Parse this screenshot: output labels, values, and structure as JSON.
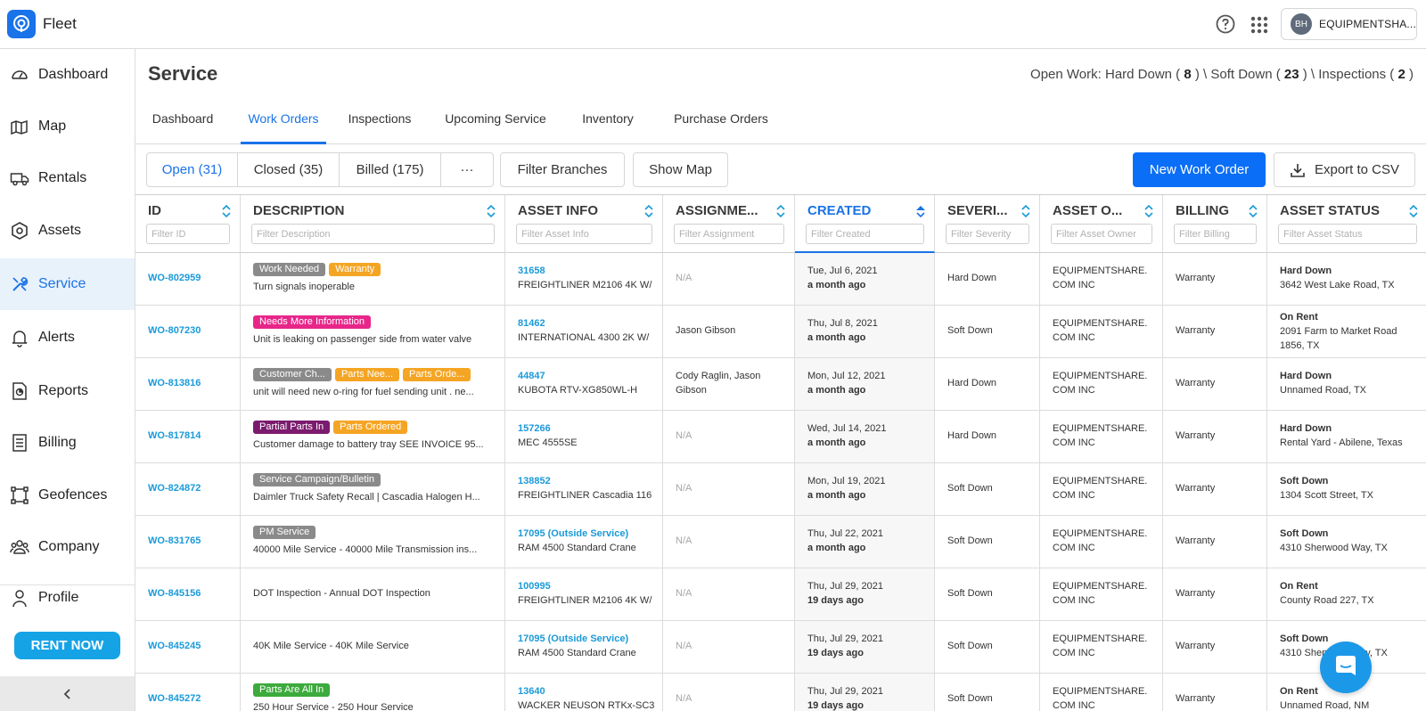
{
  "app": {
    "name": "Fleet"
  },
  "account": {
    "initials": "BH",
    "name": "EQUIPMENTSHA..."
  },
  "sidebar": {
    "items": [
      {
        "label": "Dashboard",
        "icon": "dashboard-icon"
      },
      {
        "label": "Map",
        "icon": "map-icon"
      },
      {
        "label": "Rentals",
        "icon": "truck-icon"
      },
      {
        "label": "Assets",
        "icon": "hexagon-icon"
      },
      {
        "label": "Service",
        "icon": "wrench-icon",
        "active": true
      },
      {
        "label": "Alerts",
        "icon": "bell-icon"
      },
      {
        "label": "Reports",
        "icon": "report-icon"
      },
      {
        "label": "Billing",
        "icon": "billing-icon"
      },
      {
        "label": "Geofences",
        "icon": "geofence-icon"
      },
      {
        "label": "Company",
        "icon": "company-icon"
      },
      {
        "label": "Profile",
        "icon": "profile-icon"
      }
    ],
    "rent_now": "RENT NOW"
  },
  "page": {
    "title": "Service",
    "open_work_label": "Open Work:",
    "hard_down_label": "Hard Down (",
    "hard_down_count": "8",
    "soft_down_label": ") \\ Soft Down (",
    "soft_down_count": "23",
    "inspections_label": ") \\ Inspections (",
    "inspections_count": "2",
    "close_paren": ")"
  },
  "tabs": [
    "Dashboard",
    "Work Orders",
    "Inspections",
    "Upcoming Service",
    "Inventory",
    "Purchase Orders"
  ],
  "toolbar": {
    "open": "Open (31)",
    "closed": "Closed (35)",
    "billed": "Billed (175)",
    "more": "···",
    "filter_branches": "Filter Branches",
    "show_map": "Show Map",
    "new_work_order": "New Work Order",
    "export": "Export to CSV"
  },
  "columns": [
    {
      "label": "ID",
      "placeholder": "Filter ID"
    },
    {
      "label": "DESCRIPTION",
      "placeholder": "Filter Description"
    },
    {
      "label": "ASSET INFO",
      "placeholder": "Filter Asset Info"
    },
    {
      "label": "ASSIGNME...",
      "placeholder": "Filter Assignment"
    },
    {
      "label": "CREATED",
      "placeholder": "Filter Created"
    },
    {
      "label": "SEVERI...",
      "placeholder": "Filter Severity"
    },
    {
      "label": "ASSET O...",
      "placeholder": "Filter Asset Owner"
    },
    {
      "label": "BILLING",
      "placeholder": "Filter Billing"
    },
    {
      "label": "ASSET STATUS",
      "placeholder": "Filter Asset Status"
    }
  ],
  "tag_colors": {
    "gray": "#8a8a8a",
    "orange": "#f5a524",
    "pink": "#e8268a",
    "purple": "#7b1b6e",
    "green": "#3caa3c"
  },
  "rows": [
    {
      "id": "WO-802959",
      "tags": [
        {
          "text": "Work Needed",
          "color": "gray"
        },
        {
          "text": "Warranty",
          "color": "orange"
        }
      ],
      "desc": "Turn signals inoperable",
      "asset_id": "31658",
      "asset_name": "FREIGHTLINER M2106 4K W/",
      "assignment": "N/A",
      "assignment_na": true,
      "created_date": "Tue, Jul 6, 2021",
      "created_ago": "a month ago",
      "severity": "Hard Down",
      "owner1": "EQUIPMENTSHARE.",
      "owner2": "COM INC",
      "billing": "Warranty",
      "status": "Hard Down",
      "location": "3642 West Lake Road, TX"
    },
    {
      "id": "WO-807230",
      "tags": [
        {
          "text": "Needs More Information",
          "color": "pink"
        }
      ],
      "desc": "Unit is leaking on passenger side from water valve",
      "asset_id": "81462",
      "asset_name": "INTERNATIONAL 4300 2K W/",
      "assignment": "Jason Gibson",
      "created_date": "Thu, Jul 8, 2021",
      "created_ago": "a month ago",
      "severity": "Soft Down",
      "owner1": "EQUIPMENTSHARE.",
      "owner2": "COM INC",
      "billing": "Warranty",
      "status": "On Rent",
      "location": "2091 Farm to Market Road",
      "location2": "1856, TX"
    },
    {
      "id": "WO-813816",
      "tags": [
        {
          "text": "Customer Ch...",
          "color": "gray"
        },
        {
          "text": "Parts Nee...",
          "color": "orange"
        },
        {
          "text": "Parts Orde...",
          "color": "orange"
        }
      ],
      "desc": "unit will need new o-ring for fuel sending unit . ne...",
      "asset_id": "44847",
      "asset_name": "KUBOTA RTV-XG850WL-H",
      "assignment": "Cody Raglin, Jason",
      "assignment2": "Gibson",
      "created_date": "Mon, Jul 12, 2021",
      "created_ago": "a month ago",
      "severity": "Hard Down",
      "owner1": "EQUIPMENTSHARE.",
      "owner2": "COM INC",
      "billing": "Warranty",
      "status": "Hard Down",
      "location": "Unnamed Road, TX"
    },
    {
      "id": "WO-817814",
      "tags": [
        {
          "text": "Partial Parts In",
          "color": "purple"
        },
        {
          "text": "Parts Ordered",
          "color": "orange"
        }
      ],
      "desc": "Customer damage to battery tray SEE INVOICE 95...",
      "asset_id": "157266",
      "asset_name": "MEC 4555SE",
      "assignment": "N/A",
      "assignment_na": true,
      "created_date": "Wed, Jul 14, 2021",
      "created_ago": "a month ago",
      "severity": "Hard Down",
      "owner1": "EQUIPMENTSHARE.",
      "owner2": "COM INC",
      "billing": "Warranty",
      "status": "Hard Down",
      "location": "Rental Yard - Abilene, Texas"
    },
    {
      "id": "WO-824872",
      "tags": [
        {
          "text": "Service Campaign/Bulletin",
          "color": "gray"
        }
      ],
      "desc": "Daimler Truck Safety Recall | Cascadia Halogen H...",
      "asset_id": "138852",
      "asset_name": "FREIGHTLINER Cascadia 116",
      "assignment": "N/A",
      "assignment_na": true,
      "created_date": "Mon, Jul 19, 2021",
      "created_ago": "a month ago",
      "severity": "Soft Down",
      "owner1": "EQUIPMENTSHARE.",
      "owner2": "COM INC",
      "billing": "Warranty",
      "status": "Soft Down",
      "location": "1304 Scott Street, TX"
    },
    {
      "id": "WO-831765",
      "tags": [
        {
          "text": "PM Service",
          "color": "gray"
        }
      ],
      "desc": "40000 Mile Service - 40000 Mile Transmission ins...",
      "asset_id": "17095 (Outside Service)",
      "asset_name": "RAM 4500 Standard Crane",
      "assignment": "N/A",
      "assignment_na": true,
      "created_date": "Thu, Jul 22, 2021",
      "created_ago": "a month ago",
      "severity": "Soft Down",
      "owner1": "EQUIPMENTSHARE.",
      "owner2": "COM INC",
      "billing": "Warranty",
      "status": "Soft Down",
      "location": "4310 Sherwood Way, TX"
    },
    {
      "id": "WO-845156",
      "tags": [],
      "desc": "DOT Inspection - Annual DOT Inspection",
      "asset_id": "100995",
      "asset_name": "FREIGHTLINER M2106 4K W/",
      "assignment": "N/A",
      "assignment_na": true,
      "created_date": "Thu, Jul 29, 2021",
      "created_ago": "19 days ago",
      "severity": "Soft Down",
      "owner1": "EQUIPMENTSHARE.",
      "owner2": "COM INC",
      "billing": "Warranty",
      "status": "On Rent",
      "location": "County Road 227, TX"
    },
    {
      "id": "WO-845245",
      "tags": [],
      "desc": "40K Mile Service - 40K Mile Service",
      "asset_id": "17095 (Outside Service)",
      "asset_name": "RAM 4500 Standard Crane",
      "assignment": "N/A",
      "assignment_na": true,
      "created_date": "Thu, Jul 29, 2021",
      "created_ago": "19 days ago",
      "severity": "Soft Down",
      "owner1": "EQUIPMENTSHARE.",
      "owner2": "COM INC",
      "billing": "Warranty",
      "status": "Soft Down",
      "location": "4310 Sherwood Way, TX"
    },
    {
      "id": "WO-845272",
      "tags": [
        {
          "text": "Parts Are All In",
          "color": "green"
        }
      ],
      "desc": "250 Hour Service - 250 Hour Service",
      "asset_id": "13640",
      "asset_name": "WACKER NEUSON RTKx-SC3",
      "assignment": "N/A",
      "assignment_na": true,
      "created_date": "Thu, Jul 29, 2021",
      "created_ago": "19 days ago",
      "severity": "Soft Down",
      "owner1": "EQUIPMENTSHARE.",
      "owner2": "COM INC",
      "billing": "Warranty",
      "status": "On Rent",
      "location": "Unnamed Road, NM"
    }
  ]
}
